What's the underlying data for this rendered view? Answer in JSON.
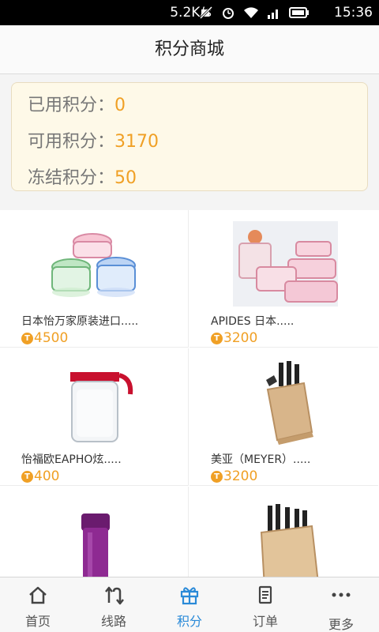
{
  "status_bar": {
    "speed": "5.2K/s",
    "time": "15:36"
  },
  "header": {
    "title": "积分商城"
  },
  "points": [
    {
      "label": "已用积分：",
      "value": "0"
    },
    {
      "label": "可用积分：",
      "value": "3170"
    },
    {
      "label": "冻结积分：",
      "value": "50"
    }
  ],
  "products": [
    {
      "name": "日本怡万家原装进口.....",
      "price": "4500",
      "icon": "glass-containers"
    },
    {
      "name": "APIDES 日本.....",
      "price": "3200",
      "icon": "pink-containers"
    },
    {
      "name": "怡福欧EAPHO炫.....",
      "price": "400",
      "icon": "glass-pitcher"
    },
    {
      "name": "美亚（MEYER）.....",
      "price": "3200",
      "icon": "knife-block"
    },
    {
      "name": "",
      "price": "",
      "icon": "purple-thermos"
    },
    {
      "name": "",
      "price": "",
      "icon": "knife-block-large"
    }
  ],
  "bottom_nav": [
    {
      "label": "首页",
      "icon": "home-icon"
    },
    {
      "label": "线路",
      "icon": "route-icon"
    },
    {
      "label": "积分",
      "icon": "gift-icon",
      "active": true
    },
    {
      "label": "订单",
      "icon": "order-icon"
    },
    {
      "label": "更多",
      "icon": "more-icon"
    }
  ],
  "colors": {
    "accent": "#2a8ad8",
    "points": "#f0a025"
  }
}
